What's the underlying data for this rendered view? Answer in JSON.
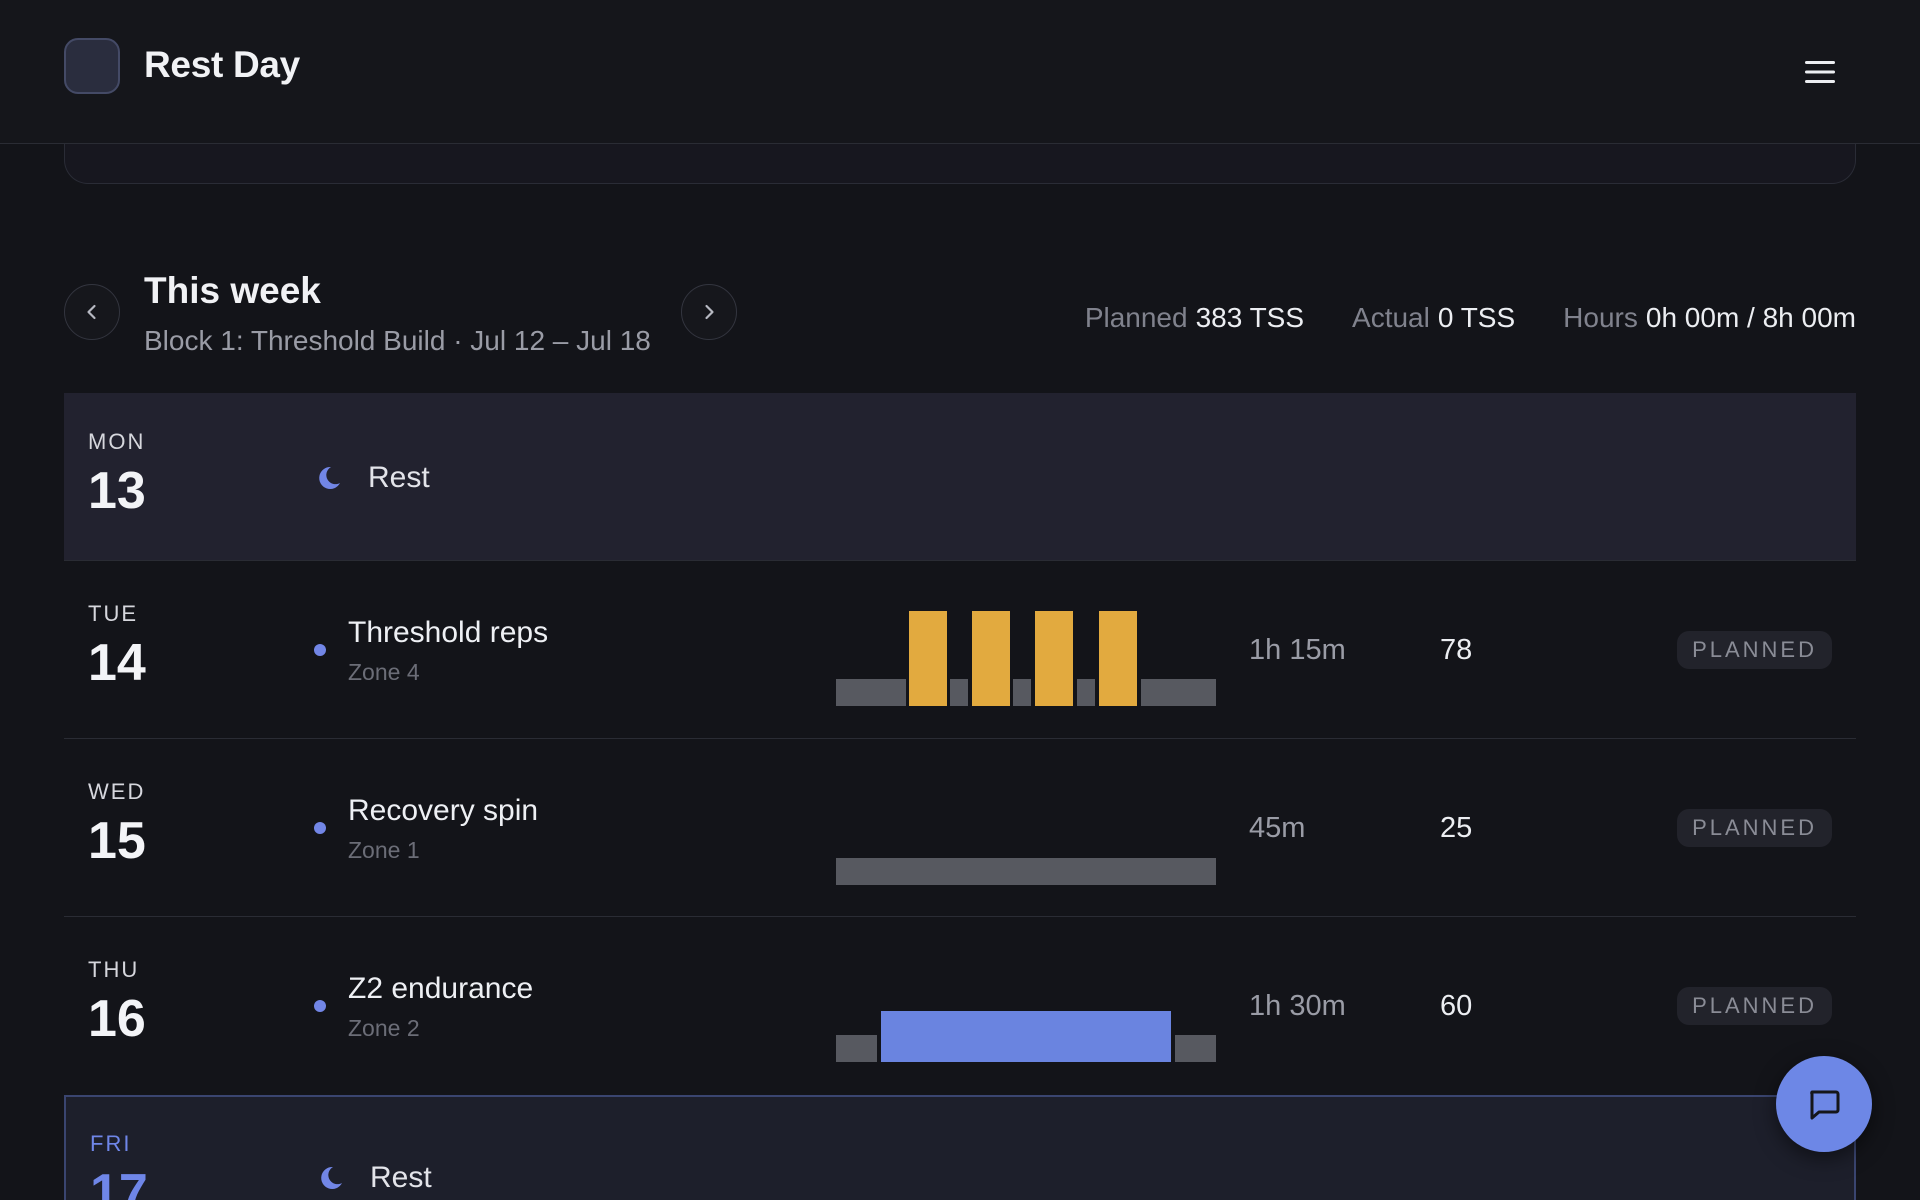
{
  "app": {
    "title": "Rest Day"
  },
  "week": {
    "title": "This week",
    "subtitle": "Block 1: Threshold Build · Jul 12 – Jul 18",
    "stats": [
      {
        "label": "Planned",
        "value": "383 TSS"
      },
      {
        "label": "Actual",
        "value": "0 TSS"
      },
      {
        "label": "Hours",
        "value": "0h 00m / 8h 00m"
      }
    ]
  },
  "days": [
    {
      "dow": "MON",
      "dom": "13",
      "type": "rest",
      "label": "Rest"
    },
    {
      "dow": "TUE",
      "dom": "14",
      "type": "workout",
      "title": "Threshold reps",
      "zone": "Zone 4",
      "duration": "1h 15m",
      "tss": "78",
      "status": "PLANNED"
    },
    {
      "dow": "WED",
      "dom": "15",
      "type": "workout",
      "title": "Recovery spin",
      "zone": "Zone 1",
      "duration": "45m",
      "tss": "25",
      "status": "PLANNED"
    },
    {
      "dow": "THU",
      "dom": "16",
      "type": "workout",
      "title": "Z2 endurance",
      "zone": "Zone 2",
      "duration": "1h 30m",
      "tss": "60",
      "status": "PLANNED"
    },
    {
      "dow": "FRI",
      "dom": "17",
      "type": "rest",
      "label": "Rest",
      "today": true
    }
  ],
  "colors": {
    "accent": "#6d87e6",
    "threshold": "#e2aa3f",
    "endurance": "#6a84e0",
    "recovery": "#575960"
  },
  "icons": {
    "menu": "hamburger-icon",
    "prev": "chevron-left-icon",
    "next": "chevron-right-icon",
    "rest": "moon-icon",
    "chat": "chat-bubble-icon"
  }
}
